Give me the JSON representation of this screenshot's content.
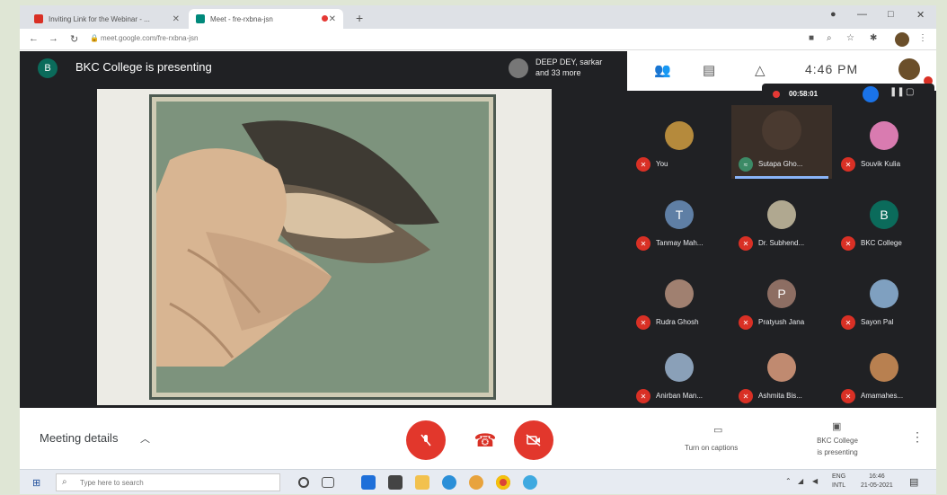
{
  "browser": {
    "tabs": [
      {
        "title": "Inviting Link for the Webinar - ...",
        "favicon_color": "#d93025"
      },
      {
        "title": "Meet - fre-rxbna-jsn",
        "favicon_color": "#00897b"
      }
    ],
    "new_tab": "+",
    "url": "meet.google.com/fre-rxbna-jsn",
    "win_minimize": "—",
    "win_maximize": "□",
    "win_close": "✕"
  },
  "presentation": {
    "presenter_initial": "B",
    "title": "BKC College is presenting",
    "viewers_line1": "DEEP DEY, sarkar",
    "viewers_line2": "and 33 more"
  },
  "panel": {
    "clock": "4:46 PM",
    "recording_time": "00:58:01",
    "participants": [
      {
        "name": "You",
        "initial": "",
        "color": "#b58a3c"
      },
      {
        "name": "Sutapa Gho...",
        "initial": "",
        "color": "#4a3a30",
        "active": true
      },
      {
        "name": "Souvik Kulia",
        "initial": "",
        "color": "#d97bb0"
      },
      {
        "name": "Tanmay Mah...",
        "initial": "T",
        "color": "#5f7fa5"
      },
      {
        "name": "Dr. Subhend...",
        "initial": "",
        "color": "#b0a890"
      },
      {
        "name": "BKC College",
        "initial": "B",
        "color": "#0b6b5b"
      },
      {
        "name": "Rudra Ghosh",
        "initial": "",
        "color": "#a08070"
      },
      {
        "name": "Pratyush Jana",
        "initial": "P",
        "color": "#8d6e63"
      },
      {
        "name": "Sayon Pal",
        "initial": "",
        "color": "#7fa0c0"
      },
      {
        "name": "Anirban Man...",
        "initial": "",
        "color": "#8aa0b8"
      },
      {
        "name": "Ashmita Bis...",
        "initial": "",
        "color": "#c08a70"
      },
      {
        "name": "Amamahes...",
        "initial": "",
        "color": "#b88050"
      }
    ]
  },
  "bottom": {
    "meeting_details": "Meeting details",
    "captions_label": "Turn on captions",
    "present_label_1": "BKC College",
    "present_label_2": "is presenting"
  },
  "taskbar": {
    "search_placeholder": "Type here to search",
    "lang_1": "ENG",
    "lang_2": "INTL",
    "time": "16:46",
    "date": "21-05-2021"
  }
}
